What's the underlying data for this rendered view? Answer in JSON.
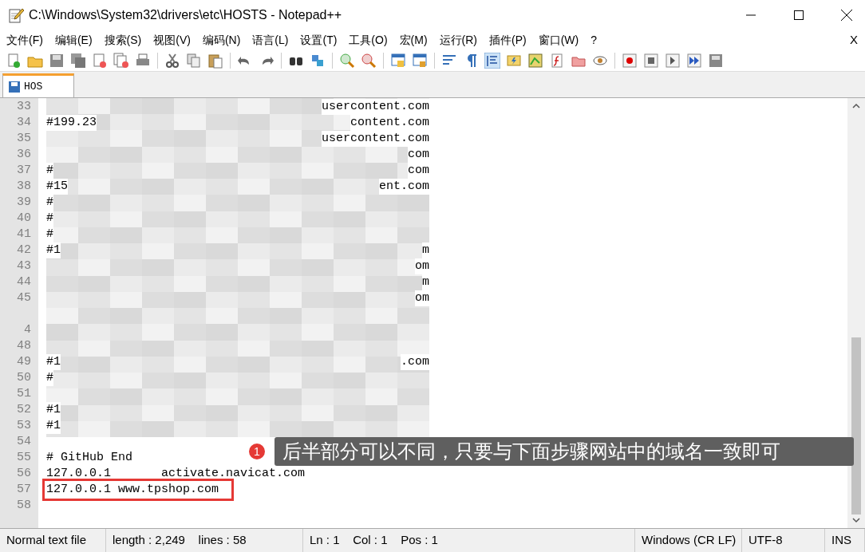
{
  "window": {
    "title": "C:\\Windows\\System32\\drivers\\etc\\HOSTS - Notepad++"
  },
  "menu": [
    "文件(F)",
    "编辑(E)",
    "搜索(S)",
    "视图(V)",
    "编码(N)",
    "语言(L)",
    "设置(T)",
    "工具(O)",
    "宏(M)",
    "运行(R)",
    "插件(P)",
    "窗口(W)",
    "?"
  ],
  "menu_close": "X",
  "tabs": [
    {
      "label": "HOS",
      "selected": true
    }
  ],
  "lines": [
    {
      "kind": "code",
      "number": "33",
      "right": "usercontent.com"
    },
    {
      "kind": "code",
      "number": "34",
      "left": "#199.23",
      "right": "content.com"
    },
    {
      "kind": "code",
      "number": "35",
      "right": "usercontent.com"
    },
    {
      "kind": "code",
      "number": "36",
      "right": "com"
    },
    {
      "kind": "code",
      "number": "37",
      "left": "#",
      "right": "com"
    },
    {
      "kind": "code",
      "number": "38",
      "left": "#15",
      "right": "ent.com"
    },
    {
      "kind": "code",
      "number": "39",
      "left": "#"
    },
    {
      "kind": "code",
      "number": "40",
      "left": "#"
    },
    {
      "kind": "code",
      "number": "41",
      "left": "#"
    },
    {
      "kind": "code",
      "number": "42",
      "left": "#1",
      "right": "m"
    },
    {
      "kind": "code",
      "number": "43",
      "right": "om"
    },
    {
      "kind": "code",
      "number": "44",
      "right": "m"
    },
    {
      "kind": "code",
      "number": "45",
      "right": "om"
    },
    {
      "kind": "covered"
    },
    {
      "kind": "code",
      "number": "4"
    },
    {
      "kind": "code",
      "number": "48"
    },
    {
      "kind": "code",
      "number": "49",
      "left": "#1",
      "right": ".com"
    },
    {
      "kind": "code",
      "number": "50",
      "left": "#"
    },
    {
      "kind": "code",
      "number": "51"
    },
    {
      "kind": "code",
      "number": "52",
      "left": "#1"
    },
    {
      "kind": "code",
      "number": "53",
      "left": "#1"
    },
    {
      "kind": "code",
      "number": "54"
    },
    {
      "kind": "code",
      "number": "55",
      "left": "# GitHub End"
    },
    {
      "kind": "code",
      "number": "56",
      "left": "127.0.0.1       activate.navicat.com"
    },
    {
      "kind": "code",
      "number": "57",
      "left": "127.0.0.1 www.tpshop.com",
      "highlighted": true
    },
    {
      "kind": "code",
      "number": "58"
    }
  ],
  "callout": {
    "badge": "1",
    "text": "后半部分可以不同，只要与下面步骤网站中的域名一致即可"
  },
  "status_bar": [
    "Normal text file",
    "length : 2,249    lines : 58",
    "Ln : 1    Col : 1    Pos : 1",
    "Windows (CR LF)",
    "UTF-8",
    "INS"
  ]
}
